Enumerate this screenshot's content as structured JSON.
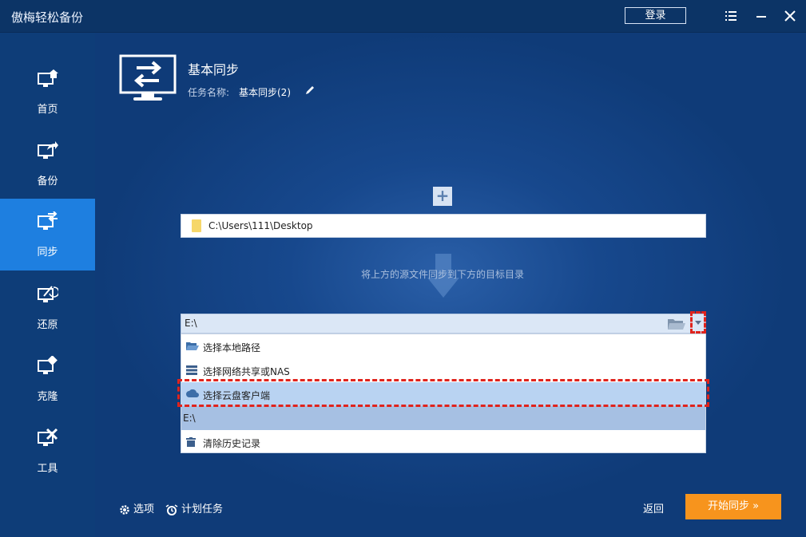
{
  "app": {
    "title": "傲梅轻松备份",
    "login_label": "登录"
  },
  "window_icons": [
    "menu-icon",
    "minimize-icon",
    "close-icon"
  ],
  "sidebar": {
    "items": [
      {
        "label": "首页",
        "icon": "home-icon"
      },
      {
        "label": "备份",
        "icon": "backup-icon"
      },
      {
        "label": "同步",
        "icon": "sync-icon",
        "active": true
      },
      {
        "label": "还原",
        "icon": "restore-icon"
      },
      {
        "label": "克隆",
        "icon": "clone-icon"
      },
      {
        "label": "工具",
        "icon": "tools-icon"
      }
    ]
  },
  "header": {
    "task_type": "基本同步",
    "task_name_label": "任务名称:",
    "task_name_value": "基本同步(2)"
  },
  "source": {
    "path": "C:\\Users\\111\\Desktop"
  },
  "hint": "将上方的源文件同步到下方的目标目录",
  "destination": {
    "path": "E:\\",
    "menu": [
      {
        "label": "选择本地路径",
        "icon": "folder-open-icon"
      },
      {
        "label": "选择网络共享或NAS",
        "icon": "server-icon"
      },
      {
        "label": "选择云盘客户端",
        "icon": "cloud-icon",
        "highlighted": true
      },
      {
        "label": "E:\\",
        "history": true
      },
      {
        "label": "清除历史记录",
        "icon": "trash-icon"
      }
    ]
  },
  "footer": {
    "options_label": "选项",
    "schedule_label": "计划任务",
    "back_label": "返回",
    "start_label": "开始同步 »"
  },
  "colors": {
    "accent": "#1e7fe0",
    "start_button": "#f7941d",
    "highlight_border": "#e0231c"
  }
}
